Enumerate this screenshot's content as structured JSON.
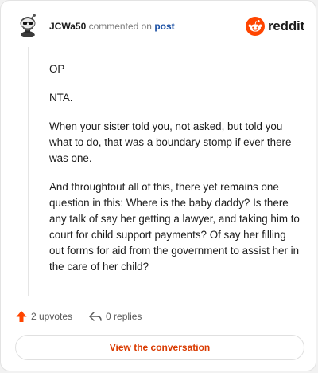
{
  "header": {
    "username": "JCWa50",
    "action_text": "commented on",
    "post_link": "post",
    "brand_name": "reddit",
    "brand_color": "#ff4500"
  },
  "comment": {
    "paragraphs": [
      "OP",
      "NTA.",
      "When your sister told you, not asked, but told you what to do, that was a boundary stomp if ever there was one.",
      "And throughtout all of this, there yet remains one question in this: Where is the baby daddy? Is there any talk of say her getting a lawyer, and taking him to court for child support payments? Of say her filling out forms for aid from the government to assist her in the care of her child?"
    ]
  },
  "actions": {
    "upvotes": "2 upvotes",
    "replies": "0 replies",
    "upvote_icon": "upvote-arrow-icon",
    "reply_icon": "reply-arrow-icon"
  },
  "footer": {
    "view_conversation": "View the conversation"
  }
}
